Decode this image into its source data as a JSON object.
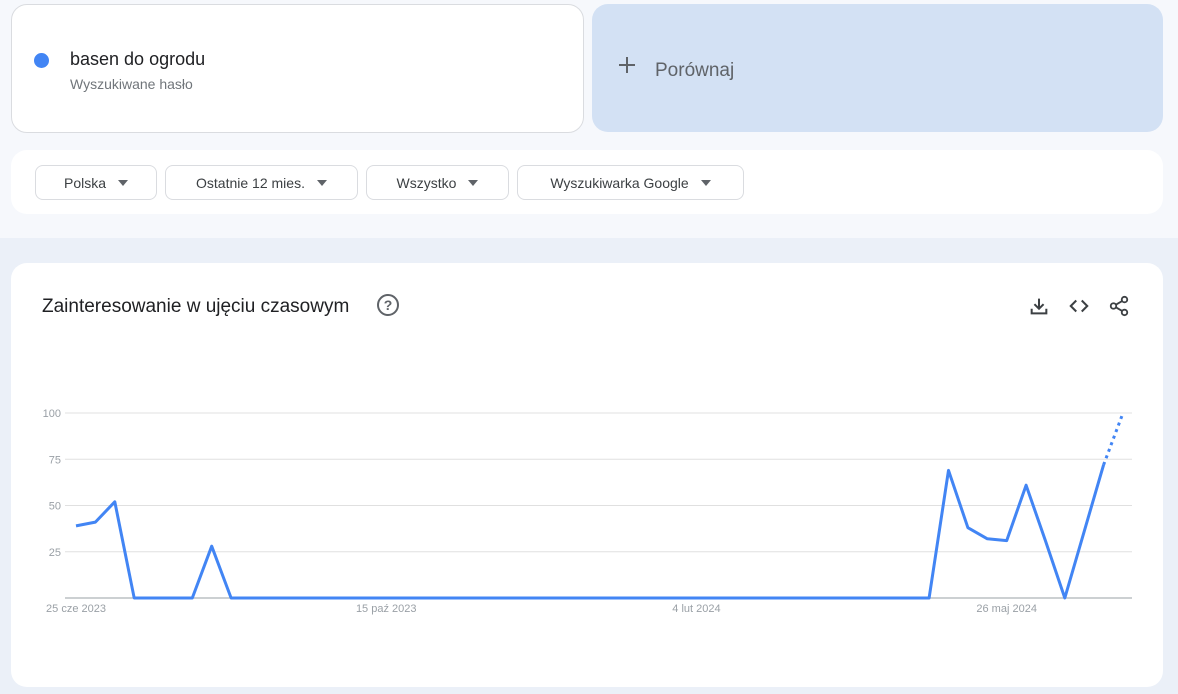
{
  "term": {
    "title": "basen do ogrodu",
    "subtitle": "Wyszukiwane hasło",
    "color": "#4285f4"
  },
  "compare": {
    "label": "Porównaj",
    "icon": "plus-icon"
  },
  "filters": [
    {
      "label": "Polska"
    },
    {
      "label": "Ostatnie 12 mies."
    },
    {
      "label": "Wszystko"
    },
    {
      "label": "Wyszukiwarka Google"
    }
  ],
  "chart": {
    "title": "Zainteresowanie w ujęciu czasowym",
    "icons": [
      "help-icon",
      "download-icon",
      "embed-code-icon",
      "share-icon"
    ]
  },
  "chart_data": {
    "type": "line",
    "title": "Zainteresowanie w ujęciu czasowym",
    "xlabel": "",
    "ylabel": "",
    "ylim": [
      0,
      100
    ],
    "yticks": [
      100,
      75,
      50,
      25
    ],
    "xticks": [
      "25 cze 2023",
      "15 paź 2023",
      "4 lut 2024",
      "26 maj 2024"
    ],
    "grid": true,
    "series": [
      {
        "values": [
          39,
          41,
          52,
          0,
          0,
          0,
          0,
          28,
          0,
          0,
          0,
          0,
          0,
          0,
          0,
          0,
          0,
          0,
          0,
          0,
          0,
          0,
          0,
          0,
          0,
          0,
          0,
          0,
          0,
          0,
          0,
          0,
          0,
          0,
          0,
          0,
          0,
          0,
          0,
          0,
          0,
          0,
          0,
          0,
          0,
          69,
          38,
          32,
          31,
          61,
          31,
          0,
          36,
          72,
          100
        ],
        "partial_last_point": true,
        "color": "#4285f4"
      }
    ]
  }
}
